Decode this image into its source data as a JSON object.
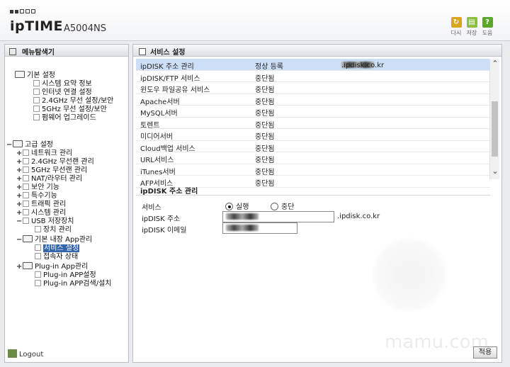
{
  "header": {
    "brand": "ipTIME",
    "model": "A5004NS",
    "buttons": [
      {
        "label": "다시",
        "icon": "refresh-icon",
        "color": "#d9a61b"
      },
      {
        "label": "저장",
        "icon": "save-icon",
        "color": "#8bbf3c"
      },
      {
        "label": "도움",
        "icon": "help-icon",
        "color": "#5aa72b"
      }
    ]
  },
  "sidebar": {
    "title": "메뉴탐색기",
    "logout": "Logout",
    "basic": {
      "label": "기본 설정",
      "items": [
        "시스템 요약 정보",
        "인터넷 연결 설정",
        "2.4GHz 무선 설정/보안",
        "5GHz 무선 설정/보안",
        "펌웨어 업그레이드"
      ]
    },
    "advanced": {
      "label": "고급 설정",
      "items": [
        "네트워크 관리",
        "2.4GHz 무선랜 관리",
        "5GHz 무선랜 관리",
        "NAT/라우터 관리",
        "보안 기능",
        "특수기능",
        "트래픽 관리",
        "시스템 관리",
        "USB 저장장치"
      ],
      "usb_children": [
        "장치 관리"
      ],
      "app_label": "기본 내장 App관리",
      "app_children": [
        "서비스 설정",
        "접속자 상태"
      ],
      "plugin_label": "Plug-in App관리",
      "plugin_children": [
        "Plug-in APP설정",
        "Plug-in APP검색/설치"
      ]
    }
  },
  "main": {
    "title": "서비스 설정",
    "services": [
      {
        "name": "ipDISK 주소 관리",
        "status": "정상 등록",
        "domain": ".ipdisk.co.kr"
      },
      {
        "name": "ipDISK/FTP 서비스",
        "status": "중단됨"
      },
      {
        "name": "윈도우 파일공유 서비스",
        "status": "중단됨"
      },
      {
        "name": "Apache서버",
        "status": "중단됨"
      },
      {
        "name": "MySQL서버",
        "status": "중단됨"
      },
      {
        "name": "토렌트",
        "status": "중단됨"
      },
      {
        "name": "미디어서버",
        "status": "중단됨"
      },
      {
        "name": "Cloud백업 서비스",
        "status": "중단됨"
      },
      {
        "name": "URL서비스",
        "status": "중단됨"
      },
      {
        "name": "iTunes서버",
        "status": "중단됨"
      },
      {
        "name": "AFP서비스",
        "status": "중단됨"
      }
    ],
    "mgmt_title": "ipDISK 주소 관리",
    "service_label": "서비스",
    "radio_run": "실행",
    "radio_stop": "중단",
    "selected": "실행",
    "addr_label": "ipDISK 주소",
    "addr_suffix": ".ipdisk.co.kr",
    "email_label": "ipDISK 이메일",
    "apply": "적용",
    "watermark": "mamu.com"
  }
}
